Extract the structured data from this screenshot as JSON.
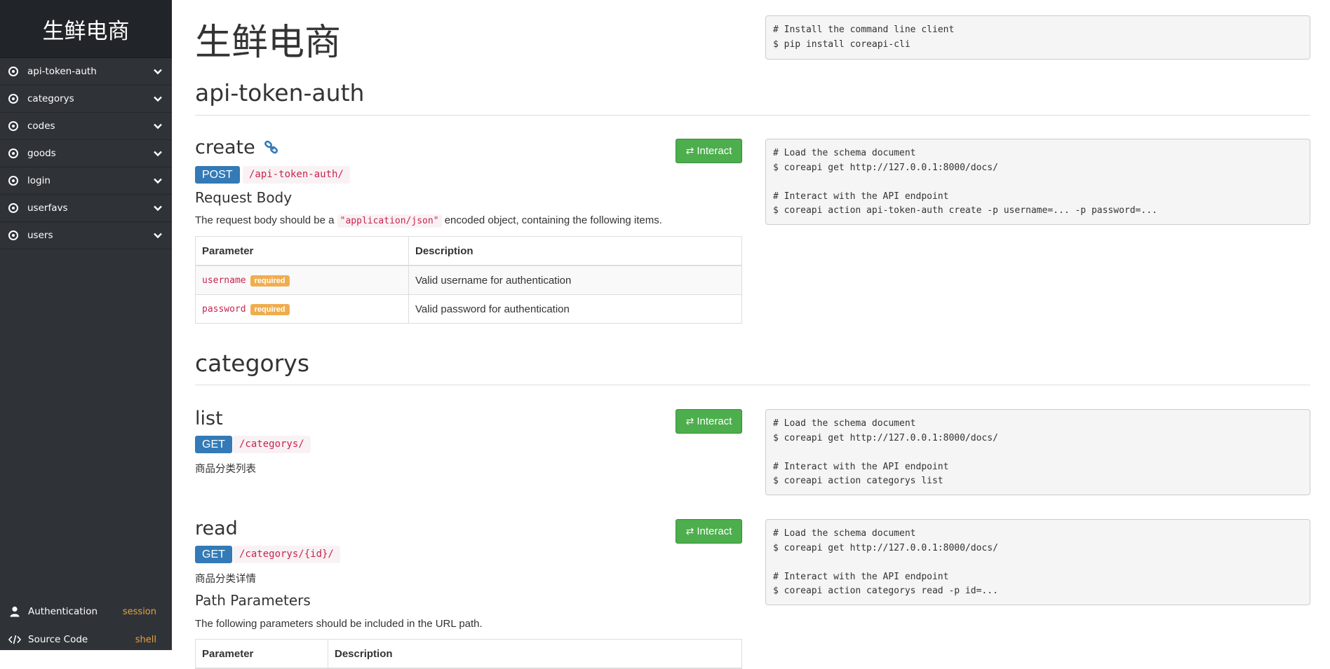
{
  "sidebar": {
    "brand": "生鲜电商",
    "items": [
      {
        "label": "api-token-auth"
      },
      {
        "label": "categorys"
      },
      {
        "label": "codes"
      },
      {
        "label": "goods"
      },
      {
        "label": "login"
      },
      {
        "label": "userfavs"
      },
      {
        "label": "users"
      }
    ],
    "footer": {
      "auth_label": "Authentication",
      "auth_value": "session",
      "source_label": "Source Code",
      "source_value": "shell"
    }
  },
  "main": {
    "title": "生鲜电商",
    "install_code": "# Install the command line client\n$ pip install coreapi-cli",
    "interact_label": "Interact",
    "sections": [
      {
        "heading": "api-token-auth",
        "endpoints": [
          {
            "name": "create",
            "method": "POST",
            "path": "/api-token-auth/",
            "request_body_heading": "Request Body",
            "request_body_prefix": "The request body should be a ",
            "request_body_code": "\"application/json\"",
            "request_body_suffix": " encoded object, containing the following items.",
            "table_headers": [
              "Parameter",
              "Description"
            ],
            "params": [
              {
                "name": "username",
                "required": "required",
                "description": "Valid username for authentication"
              },
              {
                "name": "password",
                "required": "required",
                "description": "Valid password for authentication"
              }
            ],
            "code": "# Load the schema document\n$ coreapi get http://127.0.0.1:8000/docs/\n\n# Interact with the API endpoint\n$ coreapi action api-token-auth create -p username=... -p password=..."
          }
        ]
      },
      {
        "heading": "categorys",
        "endpoints": [
          {
            "name": "list",
            "method": "GET",
            "path": "/categorys/",
            "description": "商品分类列表",
            "code": "# Load the schema document\n$ coreapi get http://127.0.0.1:8000/docs/\n\n# Interact with the API endpoint\n$ coreapi action categorys list"
          },
          {
            "name": "read",
            "method": "GET",
            "path": "/categorys/{id}/",
            "description": "商品分类详情",
            "path_params_heading": "Path Parameters",
            "path_params_text": "The following parameters should be included in the URL path.",
            "table_headers": [
              "Parameter",
              "Description"
            ],
            "code": "# Load the schema document\n$ coreapi get http://127.0.0.1:8000/docs/\n\n# Interact with the API endpoint\n$ coreapi action categorys read -p id=..."
          }
        ]
      }
    ]
  },
  "colors": {
    "sidebar_bg": "#2f3338",
    "brand_bg": "#212529",
    "method_badge": "#337ab7",
    "interact_button": "#4cae4c",
    "required_badge": "#f0ad4e",
    "path_text": "#c7254e",
    "footer_value": "#e8a040"
  },
  "icons": {
    "nav": "target-circle-icon",
    "expand": "chevron-down-icon",
    "auth": "user-icon",
    "source": "code-icon",
    "permalink": "link-icon",
    "interact": "exchange-arrows-icon"
  }
}
